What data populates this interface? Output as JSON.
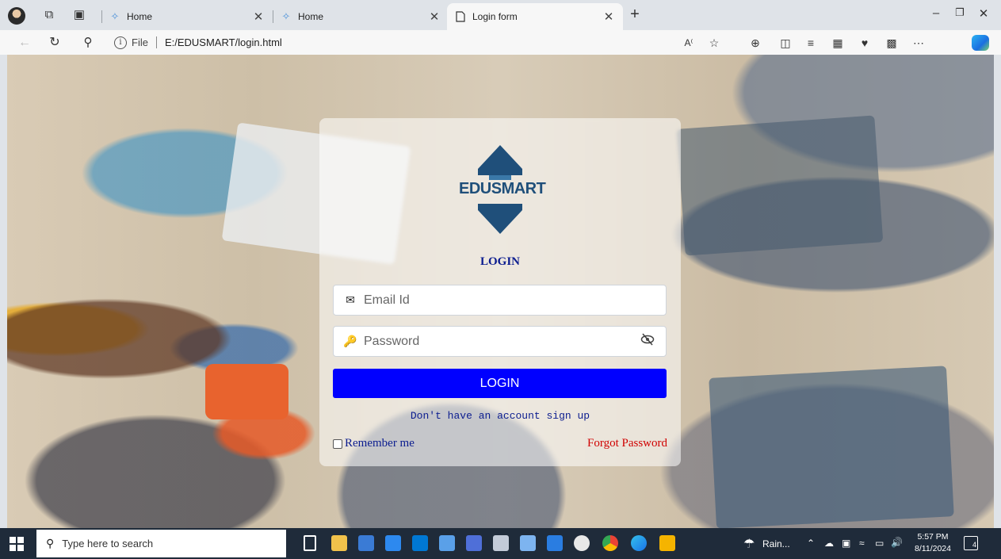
{
  "browser": {
    "tabs": [
      {
        "title": "Home",
        "favicon": "diamond-icon",
        "active": false
      },
      {
        "title": "Home",
        "favicon": "diamond-icon",
        "active": false
      },
      {
        "title": "Login form",
        "favicon": "page-icon",
        "active": true
      }
    ],
    "address": {
      "scheme_label": "File",
      "url": "E:/EDUSMART/login.html"
    }
  },
  "login": {
    "brand": "EDUSMART",
    "title": "LOGIN",
    "email_placeholder": "Email Id",
    "password_placeholder": "Password",
    "login_button": "LOGIN",
    "signup_text": "Don't have an account sign up",
    "remember_label": "Remember me",
    "forgot_label": "Forgot Password",
    "colors": {
      "button": "#0000ff",
      "link": "#0b1c8f",
      "forgot": "#d00000",
      "logo": "#1f4f7a"
    }
  },
  "taskbar": {
    "search_placeholder": "Type here to search",
    "weather": "Rain...",
    "time": "5:57 PM",
    "date": "8/11/2024",
    "notifications": "4"
  }
}
